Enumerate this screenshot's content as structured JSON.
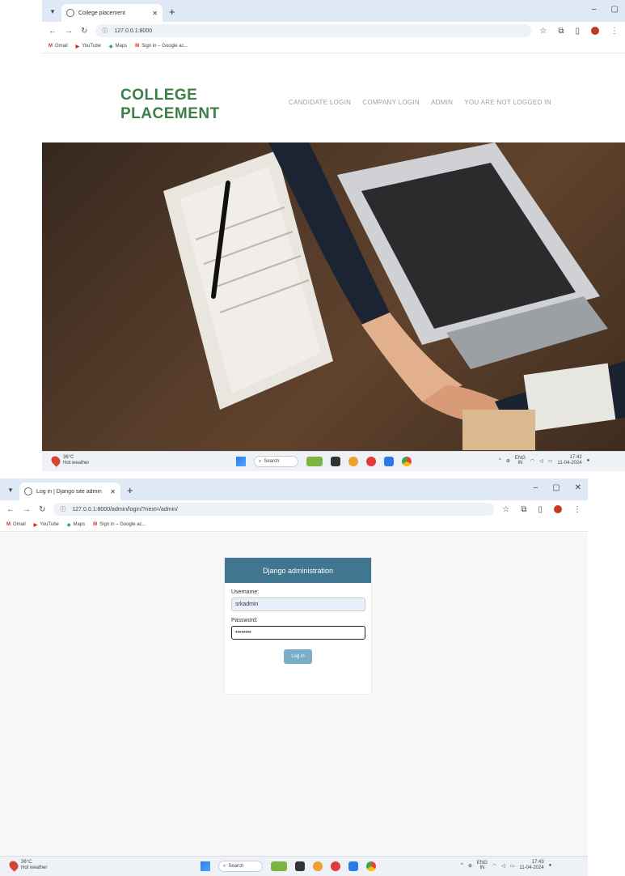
{
  "screen1": {
    "tab": {
      "title": "College placement"
    },
    "url": "127.0.0.1:8000",
    "bookmarks": [
      "Gmail",
      "YouTube",
      "Maps",
      "Sign in – Google ac..."
    ],
    "brand": {
      "line1": "COLLEGE",
      "line2": "PLACEMENT",
      "color": "#3a7f47"
    },
    "nav": [
      "CANDIDATE LOGIN",
      "COMPANY LOGIN",
      "ADMIN",
      "YOU ARE NOT LOGGED IN"
    ],
    "taskbar": {
      "weather_temp": "36°C",
      "weather_desc": "Hot weather",
      "search": "Search",
      "lang": "ENG",
      "region": "IN",
      "time": "17:42",
      "date": "11-04-2024"
    }
  },
  "screen2": {
    "tab": {
      "title": "Log in | Django site admin"
    },
    "url": "127.0.0.1:8000/admin/login/?next=/admin/",
    "bookmarks": [
      "Gmail",
      "YouTube",
      "Maps",
      "Sign in – Google ac..."
    ],
    "login": {
      "header": "Django administration",
      "username_label": "Username:",
      "username_value": "srkadmin",
      "password_label": "Password:",
      "password_value": "••••••••",
      "submit": "Log in",
      "header_color": "#417690",
      "button_color": "#79aec8"
    },
    "taskbar": {
      "weather_temp": "36°C",
      "weather_desc": "Hot weather",
      "search": "Search",
      "lang": "ENG",
      "region": "IN",
      "time": "17:43",
      "date": "11-04-2024"
    }
  }
}
